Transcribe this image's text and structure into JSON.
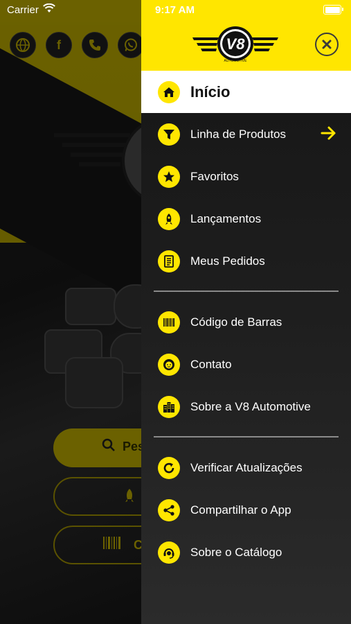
{
  "status_bar": {
    "carrier": "Carrier",
    "time": "9:17 AM"
  },
  "brand": {
    "logo_text": "V8",
    "logo_subtext": "AUTOMOTIVE"
  },
  "background": {
    "buttons": [
      {
        "label": "Pes",
        "icon": "search-icon"
      },
      {
        "label": "",
        "icon": "rocket-icon"
      },
      {
        "label": "C",
        "icon": "barcode-icon"
      }
    ],
    "social_icons": [
      "globe-icon",
      "facebook-icon",
      "phone-icon",
      "whatsapp-icon"
    ]
  },
  "menu": {
    "items": [
      {
        "label": "Início",
        "icon": "home-icon",
        "active": true
      },
      {
        "label": "Linha de Produtos",
        "icon": "filter-icon",
        "has_arrow": true
      },
      {
        "label": "Favoritos",
        "icon": "star-icon"
      },
      {
        "label": "Lançamentos",
        "icon": "rocket-icon"
      },
      {
        "label": "Meus Pedidos",
        "icon": "document-icon"
      },
      {
        "label": "Código de Barras",
        "icon": "barcode-icon"
      },
      {
        "label": "Contato",
        "icon": "contact-icon"
      },
      {
        "label": "Sobre a V8 Automotive",
        "icon": "building-icon"
      },
      {
        "label": "Verificar Atualizações",
        "icon": "refresh-icon"
      },
      {
        "label": "Compartilhar o App",
        "icon": "share-icon"
      },
      {
        "label": "Sobre o Catálogo",
        "icon": "support-icon"
      }
    ]
  },
  "colors": {
    "accent": "#ffe600",
    "drawer_bg": "#1e1e1e",
    "active_bg": "#ffffff"
  }
}
